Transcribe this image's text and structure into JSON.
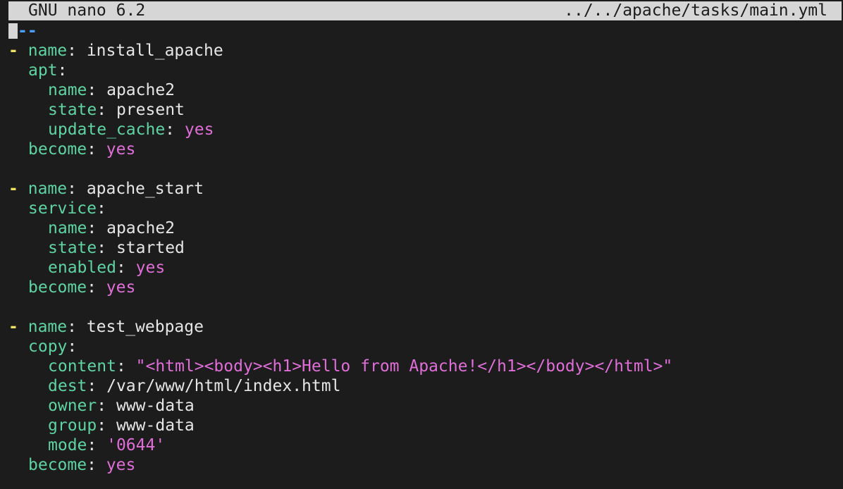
{
  "titlebar": {
    "app": "GNU nano 6.2",
    "file": "../../apache/tasks/main.yml"
  },
  "doc_marker": "--",
  "tasks": [
    {
      "name_key": "name",
      "name_value": "install_apache",
      "module": "apt",
      "params": [
        {
          "key": "name",
          "value": "apache2",
          "type": "plain"
        },
        {
          "key": "state",
          "value": "present",
          "type": "plain"
        },
        {
          "key": "update_cache",
          "value": "yes",
          "type": "bool"
        }
      ],
      "become_key": "become",
      "become_value": "yes"
    },
    {
      "name_key": "name",
      "name_value": "apache_start",
      "module": "service",
      "params": [
        {
          "key": "name",
          "value": "apache2",
          "type": "plain"
        },
        {
          "key": "state",
          "value": "started",
          "type": "plain"
        },
        {
          "key": "enabled",
          "value": "yes",
          "type": "bool"
        }
      ],
      "become_key": "become",
      "become_value": "yes"
    },
    {
      "name_key": "name",
      "name_value": "test_webpage",
      "module": "copy",
      "params": [
        {
          "key": "content",
          "value": "\"<html><body><h1>Hello from Apache!</h1></body></html>\"",
          "type": "string"
        },
        {
          "key": "dest",
          "value": "/var/www/html/index.html",
          "type": "plain"
        },
        {
          "key": "owner",
          "value": "www-data",
          "type": "plain"
        },
        {
          "key": "group",
          "value": "www-data",
          "type": "plain"
        },
        {
          "key": "mode",
          "value": "'0644'",
          "type": "string"
        }
      ],
      "become_key": "become",
      "become_value": "yes"
    }
  ],
  "colors": {
    "background": "#1c1c1c",
    "titlebar": "#d6d6d6",
    "key": "#5fd4a2",
    "bool_string": "#e06ed8",
    "dash": "#f0e060",
    "doc_marker": "#4aa0ff"
  }
}
